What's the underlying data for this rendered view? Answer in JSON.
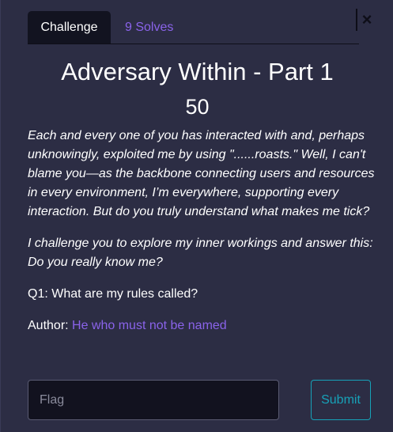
{
  "dialog": {
    "close_label": "×"
  },
  "tabs": [
    {
      "label": "Challenge",
      "active": true
    },
    {
      "label": "9 Solves",
      "active": false
    }
  ],
  "challenge": {
    "title": "Adversary Within - Part 1",
    "points": "50",
    "description_p1": "Each and every one of you has interacted with and, perhaps unknowingly, exploited me by using \"......roasts.\" Well, I can't blame you—as the backbone connecting users and resources in every environment, I’m everywhere, supporting every interaction. But do you truly understand what makes me tick?",
    "description_p2": "I challenge you to explore my inner workings and answer this: Do you really know me?",
    "question": "Q1: What are my rules called?",
    "author_label": "Author: ",
    "author_name": "He who must not be named"
  },
  "form": {
    "flag_placeholder": "Flag",
    "flag_value": "",
    "submit_label": "Submit"
  },
  "colors": {
    "background": "#2c2d44",
    "accent": "#8a63ea",
    "submit": "#17a2b8",
    "tab_active_bg": "#121320"
  }
}
